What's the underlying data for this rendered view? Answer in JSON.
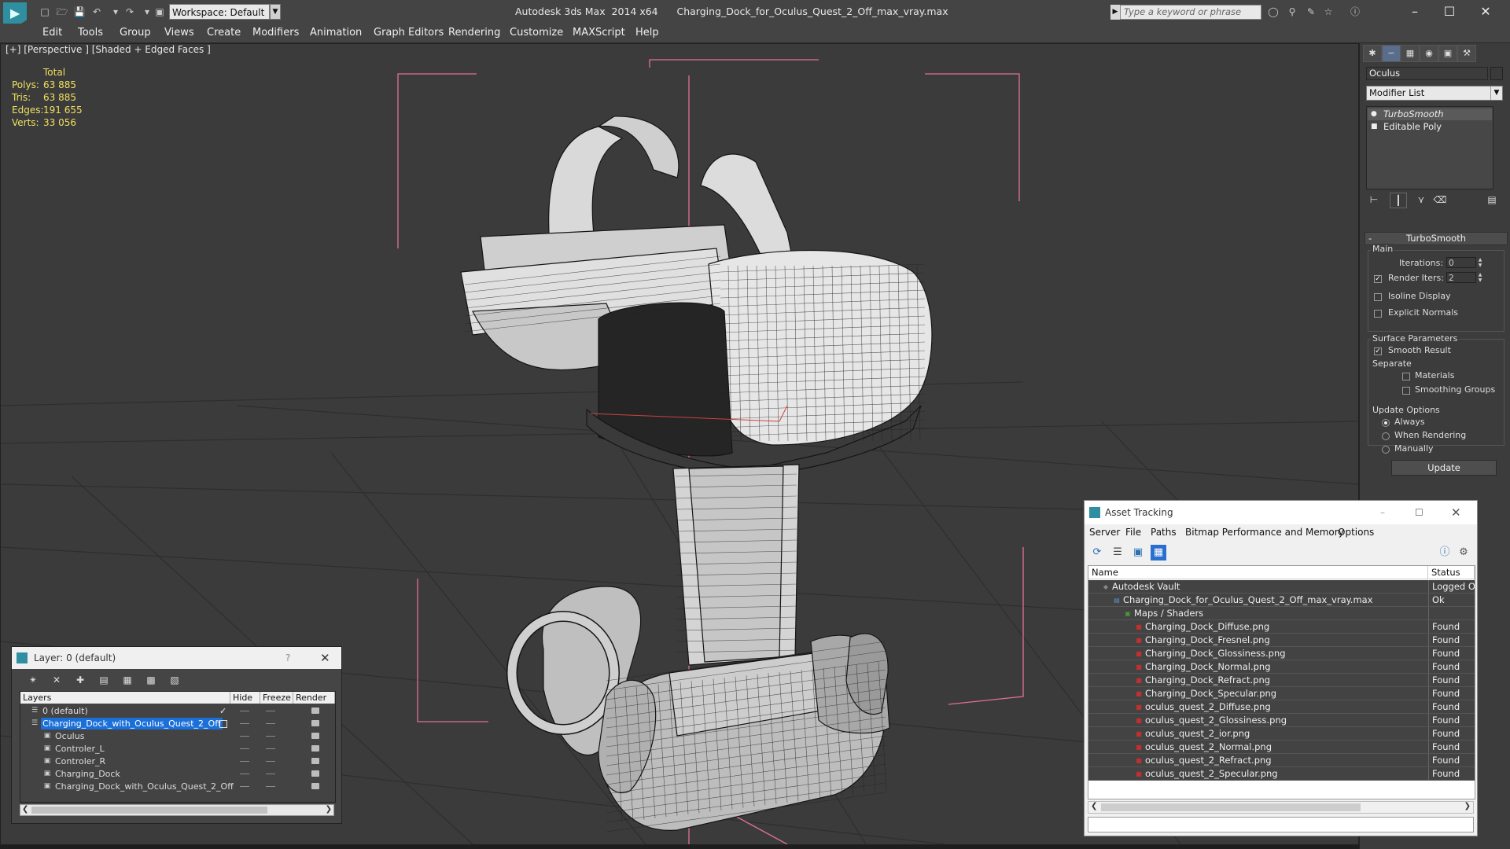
{
  "titlebar": {
    "workspace": "Workspace: Default",
    "app_title": "Autodesk 3ds Max  2014 x64",
    "file_title": "Charging_Dock_for_Oculus_Quest_2_Off_max_vray.max",
    "search_placeholder": "Type a keyword or phrase"
  },
  "menu": [
    "Edit",
    "Tools",
    "Group",
    "Views",
    "Create",
    "Modifiers",
    "Animation",
    "Graph Editors",
    "Rendering",
    "Customize",
    "MAXScript",
    "Help"
  ],
  "viewport": {
    "label": "[+] [Perspective ] [Shaded + Edged Faces ]",
    "stats": {
      "header": "Total",
      "rows": [
        {
          "label": "Polys:",
          "value": "63 885"
        },
        {
          "label": "Tris:",
          "value": "63 885"
        },
        {
          "label": "Edges:",
          "value": "191 655"
        },
        {
          "label": "Verts:",
          "value": "33 056"
        }
      ]
    },
    "colors": {
      "bg": "#3b3b3b",
      "grid": "#2e2e2e",
      "wire": "#151515",
      "bbox": "#e0709a"
    }
  },
  "command_panel": {
    "object_name": "Oculus",
    "modifier_list": "Modifier List",
    "stack": [
      "TurboSmooth",
      "Editable Poly"
    ],
    "turbosmooth": {
      "title": "TurboSmooth",
      "main_label": "Main",
      "iterations_label": "Iterations:",
      "iterations_value": "0",
      "render_iters_label": "Render Iters:",
      "render_iters_value": "2",
      "isoline_label": "Isoline Display",
      "explicit_label": "Explicit Normals",
      "surface_label": "Surface Parameters",
      "smooth_result_label": "Smooth Result",
      "separate_label": "Separate",
      "materials_label": "Materials",
      "smoothing_groups_label": "Smoothing Groups",
      "update_options_label": "Update Options",
      "always_label": "Always",
      "when_rendering_label": "When Rendering",
      "manually_label": "Manually",
      "update_button": "Update"
    }
  },
  "layer_dialog": {
    "title": "Layer: 0 (default)",
    "help": "?",
    "columns": [
      "Layers",
      "Hide",
      "Freeze",
      "Render"
    ],
    "rows": [
      {
        "name": "0 (default)",
        "indent": 0,
        "icon": "layer-icon",
        "selected": false,
        "current": true
      },
      {
        "name": "Charging_Dock_with_Oculus_Quest_2_Off",
        "indent": 0,
        "icon": "layer-icon",
        "selected": true,
        "current": false
      },
      {
        "name": "Oculus",
        "indent": 1,
        "icon": "object-icon",
        "selected": false,
        "current": false
      },
      {
        "name": "Controler_L",
        "indent": 1,
        "icon": "object-icon",
        "selected": false,
        "current": false
      },
      {
        "name": "Controler_R",
        "indent": 1,
        "icon": "object-icon",
        "selected": false,
        "current": false
      },
      {
        "name": "Charging_Dock",
        "indent": 1,
        "icon": "object-icon",
        "selected": false,
        "current": false
      },
      {
        "name": "Charging_Dock_with_Oculus_Quest_2_Off",
        "indent": 1,
        "icon": "object-icon",
        "selected": false,
        "current": false
      }
    ]
  },
  "asset_dialog": {
    "title": "Asset Tracking",
    "menu": [
      "Server",
      "File",
      "Paths",
      "Bitmap Performance and Memory",
      "Options"
    ],
    "columns": [
      "Name",
      "Status"
    ],
    "rows": [
      {
        "name": "Autodesk Vault",
        "level": 0,
        "icon": "vault-icon",
        "status": "Logged O"
      },
      {
        "name": "Charging_Dock_for_Oculus_Quest_2_Off_max_vray.max",
        "level": 1,
        "icon": "max-file-icon",
        "status": "Ok"
      },
      {
        "name": "Maps / Shaders",
        "level": 2,
        "icon": "maps-icon",
        "status": ""
      },
      {
        "name": "Charging_Dock_Diffuse.png",
        "level": 3,
        "icon": "png-icon",
        "status": "Found"
      },
      {
        "name": "Charging_Dock_Fresnel.png",
        "level": 3,
        "icon": "png-icon",
        "status": "Found"
      },
      {
        "name": "Charging_Dock_Glossiness.png",
        "level": 3,
        "icon": "png-icon",
        "status": "Found"
      },
      {
        "name": "Charging_Dock_Normal.png",
        "level": 3,
        "icon": "png-icon",
        "status": "Found"
      },
      {
        "name": "Charging_Dock_Refract.png",
        "level": 3,
        "icon": "png-icon",
        "status": "Found"
      },
      {
        "name": "Charging_Dock_Specular.png",
        "level": 3,
        "icon": "png-icon",
        "status": "Found"
      },
      {
        "name": "oculus_quest_2_Diffuse.png",
        "level": 3,
        "icon": "png-icon",
        "status": "Found"
      },
      {
        "name": "oculus_quest_2_Glossiness.png",
        "level": 3,
        "icon": "png-icon",
        "status": "Found"
      },
      {
        "name": "oculus_quest_2_ior.png",
        "level": 3,
        "icon": "png-icon",
        "status": "Found"
      },
      {
        "name": "oculus_quest_2_Normal.png",
        "level": 3,
        "icon": "png-icon",
        "status": "Found"
      },
      {
        "name": "oculus_quest_2_Refract.png",
        "level": 3,
        "icon": "png-icon",
        "status": "Found"
      },
      {
        "name": "oculus_quest_2_Specular.png",
        "level": 3,
        "icon": "png-icon",
        "status": "Found"
      }
    ]
  }
}
